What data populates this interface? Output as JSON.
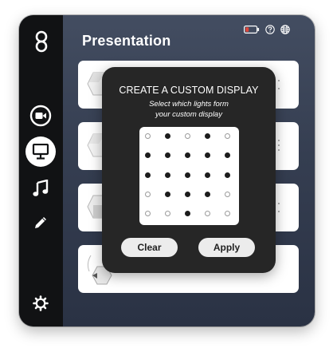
{
  "window": {
    "title": "Presentation"
  },
  "sidebar": {
    "items": [
      {
        "icon": "logo-icon"
      },
      {
        "icon": "camera-icon"
      },
      {
        "icon": "presentation-icon",
        "selected": true
      },
      {
        "icon": "music-icon"
      },
      {
        "icon": "pencil-icon"
      }
    ],
    "settings_icon": "gear-icon"
  },
  "status": {
    "icons": [
      "battery-icon",
      "help-icon",
      "globe-icon"
    ],
    "battery_color": "#e0453a"
  },
  "modal": {
    "title": "CREATE A CUSTOM DISPLAY",
    "subtitle_line1": "Select which lights form",
    "subtitle_line2": "your custom display",
    "grid": [
      [
        0,
        1,
        0,
        1,
        0
      ],
      [
        1,
        1,
        1,
        1,
        1
      ],
      [
        1,
        1,
        1,
        1,
        1
      ],
      [
        0,
        1,
        1,
        1,
        0
      ],
      [
        0,
        0,
        1,
        0,
        0
      ]
    ],
    "clear_label": "Clear",
    "apply_label": "Apply"
  },
  "colors": {
    "sidebar": "#111214",
    "modal": "#262626",
    "light_on": "#1c1c1c"
  }
}
